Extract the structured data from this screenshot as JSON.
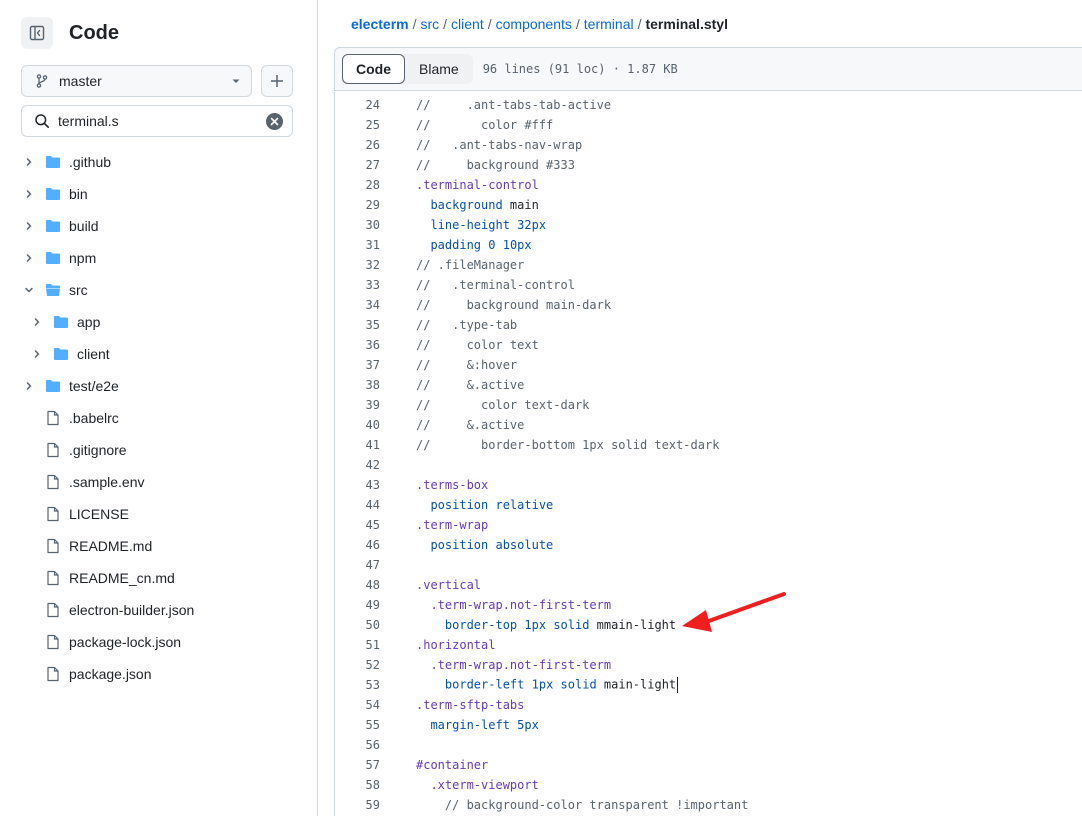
{
  "sidebar": {
    "title": "Code",
    "branch": "master",
    "search": {
      "value": "terminal.s"
    },
    "tree": [
      {
        "label": ".github",
        "type": "folder",
        "expanded": false,
        "depth": 0
      },
      {
        "label": "bin",
        "type": "folder",
        "expanded": false,
        "depth": 0
      },
      {
        "label": "build",
        "type": "folder",
        "expanded": false,
        "depth": 0
      },
      {
        "label": "npm",
        "type": "folder",
        "expanded": false,
        "depth": 0
      },
      {
        "label": "src",
        "type": "folder",
        "expanded": true,
        "depth": 0
      },
      {
        "label": "app",
        "type": "folder",
        "expanded": false,
        "depth": 1
      },
      {
        "label": "client",
        "type": "folder",
        "expanded": false,
        "depth": 1
      },
      {
        "label": "test/e2e",
        "type": "folder",
        "expanded": false,
        "depth": 0
      },
      {
        "label": ".babelrc",
        "type": "file",
        "depth": 0
      },
      {
        "label": ".gitignore",
        "type": "file",
        "depth": 0
      },
      {
        "label": ".sample.env",
        "type": "file",
        "depth": 0
      },
      {
        "label": "LICENSE",
        "type": "file",
        "depth": 0
      },
      {
        "label": "README.md",
        "type": "file",
        "depth": 0
      },
      {
        "label": "README_cn.md",
        "type": "file",
        "depth": 0
      },
      {
        "label": "electron-builder.json",
        "type": "file",
        "depth": 0
      },
      {
        "label": "package-lock.json",
        "type": "file",
        "depth": 0
      },
      {
        "label": "package.json",
        "type": "file",
        "depth": 0
      }
    ]
  },
  "breadcrumb": {
    "links": [
      "electerm",
      "src",
      "client",
      "components",
      "terminal"
    ],
    "separator": "/",
    "current": "terminal.styl"
  },
  "file_header": {
    "code_label": "Code",
    "blame_label": "Blame",
    "meta": "96 lines (91 loc) · 1.87 KB"
  },
  "code_lines": [
    {
      "n": "24",
      "tokens": [
        [
          "c",
          "//     .ant-tabs-tab-active"
        ]
      ]
    },
    {
      "n": "25",
      "tokens": [
        [
          "c",
          "//       color #fff"
        ]
      ]
    },
    {
      "n": "26",
      "tokens": [
        [
          "c",
          "//   .ant-tabs-nav-wrap"
        ]
      ]
    },
    {
      "n": "27",
      "tokens": [
        [
          "c",
          "//     background #333"
        ]
      ]
    },
    {
      "n": "28",
      "tokens": [
        [
          "s",
          ".terminal-control"
        ]
      ]
    },
    {
      "n": "29",
      "tokens": [
        [
          "w",
          "  "
        ],
        [
          "p",
          "background"
        ],
        [
          "v",
          " main"
        ]
      ]
    },
    {
      "n": "30",
      "tokens": [
        [
          "w",
          "  "
        ],
        [
          "p",
          "line-height"
        ],
        [
          "v",
          " "
        ],
        [
          "n",
          "32px"
        ]
      ]
    },
    {
      "n": "31",
      "tokens": [
        [
          "w",
          "  "
        ],
        [
          "p",
          "padding"
        ],
        [
          "v",
          " "
        ],
        [
          "n",
          "0 10px"
        ]
      ]
    },
    {
      "n": "32",
      "tokens": [
        [
          "c",
          "// .fileManager"
        ]
      ]
    },
    {
      "n": "33",
      "tokens": [
        [
          "c",
          "//   .terminal-control"
        ]
      ]
    },
    {
      "n": "34",
      "tokens": [
        [
          "c",
          "//     background main-dark"
        ]
      ]
    },
    {
      "n": "35",
      "tokens": [
        [
          "c",
          "//   .type-tab"
        ]
      ]
    },
    {
      "n": "36",
      "tokens": [
        [
          "c",
          "//     color text"
        ]
      ]
    },
    {
      "n": "37",
      "tokens": [
        [
          "c",
          "//     &:hover"
        ]
      ]
    },
    {
      "n": "38",
      "tokens": [
        [
          "c",
          "//     &.active"
        ]
      ]
    },
    {
      "n": "39",
      "tokens": [
        [
          "c",
          "//       color text-dark"
        ]
      ]
    },
    {
      "n": "40",
      "tokens": [
        [
          "c",
          "//     &.active"
        ]
      ]
    },
    {
      "n": "41",
      "tokens": [
        [
          "c",
          "//       border-bottom 1px solid text-dark"
        ]
      ]
    },
    {
      "n": "42",
      "tokens": []
    },
    {
      "n": "43",
      "tokens": [
        [
          "s",
          ".terms-box"
        ]
      ]
    },
    {
      "n": "44",
      "tokens": [
        [
          "w",
          "  "
        ],
        [
          "p",
          "position"
        ],
        [
          "v",
          " "
        ],
        [
          "n",
          "relative"
        ]
      ]
    },
    {
      "n": "45",
      "tokens": [
        [
          "s",
          ".term-wrap"
        ]
      ]
    },
    {
      "n": "46",
      "tokens": [
        [
          "w",
          "  "
        ],
        [
          "p",
          "position"
        ],
        [
          "v",
          " "
        ],
        [
          "n",
          "absolute"
        ]
      ]
    },
    {
      "n": "47",
      "tokens": []
    },
    {
      "n": "48",
      "tokens": [
        [
          "s",
          ".vertical"
        ]
      ]
    },
    {
      "n": "49",
      "tokens": [
        [
          "w",
          "  "
        ],
        [
          "s",
          ".term-wrap.not-first-term"
        ]
      ]
    },
    {
      "n": "50",
      "tokens": [
        [
          "w",
          "    "
        ],
        [
          "p",
          "border-top"
        ],
        [
          "v",
          " "
        ],
        [
          "n",
          "1px"
        ],
        [
          "v",
          " "
        ],
        [
          "n",
          "solid"
        ],
        [
          "v",
          " mmain-light"
        ]
      ]
    },
    {
      "n": "51",
      "tokens": [
        [
          "s",
          ".horizontal"
        ]
      ]
    },
    {
      "n": "52",
      "tokens": [
        [
          "w",
          "  "
        ],
        [
          "s",
          ".term-wrap.not-first-term"
        ]
      ]
    },
    {
      "n": "53",
      "tokens": [
        [
          "w",
          "    "
        ],
        [
          "p",
          "border-left"
        ],
        [
          "v",
          " "
        ],
        [
          "n",
          "1px"
        ],
        [
          "v",
          " "
        ],
        [
          "n",
          "solid"
        ],
        [
          "v",
          " main-light"
        ]
      ],
      "caret": true
    },
    {
      "n": "54",
      "tokens": [
        [
          "s",
          ".term-sftp-tabs"
        ]
      ]
    },
    {
      "n": "55",
      "tokens": [
        [
          "w",
          "  "
        ],
        [
          "p",
          "margin-left"
        ],
        [
          "v",
          " "
        ],
        [
          "n",
          "5px"
        ]
      ]
    },
    {
      "n": "56",
      "tokens": []
    },
    {
      "n": "57",
      "tokens": [
        [
          "s",
          "#container"
        ]
      ]
    },
    {
      "n": "58",
      "tokens": [
        [
          "w",
          "  "
        ],
        [
          "s",
          ".xterm-viewport"
        ]
      ]
    },
    {
      "n": "59",
      "tokens": [
        [
          "w",
          "    "
        ],
        [
          "c",
          "// background-color transparent !important"
        ]
      ]
    }
  ],
  "annotation": {
    "type": "arrow",
    "color": "#f01e1e",
    "points_to_line": "50"
  },
  "colors": {
    "link": "#0969da",
    "folder": "#54aeff",
    "comment": "#59636e",
    "selector": "#6639ba",
    "property": "#0550ae",
    "border": "#d0d7de"
  }
}
